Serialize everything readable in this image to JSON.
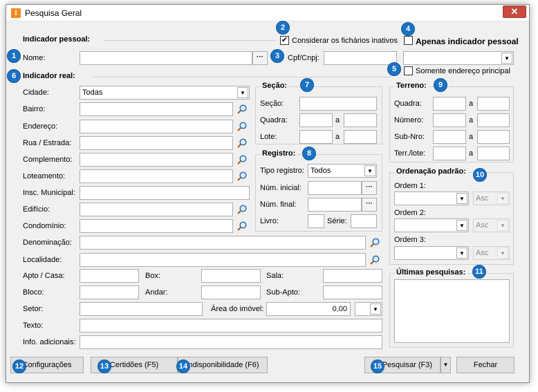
{
  "window": {
    "title": "Pesquisa Geral",
    "icon_letter": "I",
    "close_glyph": "✕"
  },
  "indicador_pessoal": {
    "label": "Indicador pessoal:",
    "nome_label": "Nome:",
    "nome_value": "",
    "cpf_label": "Cpf/Cnpj:",
    "cpf_value": "",
    "considerar_label": "Considerar os fichários inativos",
    "considerar_checked": "✔",
    "apenas_label": "Apenas indicador pessoal",
    "somente_label": "Somente endereço principal"
  },
  "indicador_real": {
    "label": "Indicador real:",
    "cidade_label": "Cidade:",
    "cidade_value": "Todas",
    "bairro_label": "Bairro:",
    "endereco_label": "Endereço:",
    "rua_label": "Rua / Estrada:",
    "complemento_label": "Complemento:",
    "loteamento_label": "Loteamento:",
    "insc_label": "Insc. Municipal:",
    "edificio_label": "Edifício:",
    "condominio_label": "Condomínio:",
    "denominacao_label": "Denominação:",
    "localidade_label": "Localidade:",
    "apto_label": "Apto / Casa:",
    "box_label": "Box:",
    "sala_label": "Sala:",
    "bloco_label": "Bloco:",
    "andar_label": "Andar:",
    "subapto_label": "Sub-Apto:",
    "setor_label": "Setor:",
    "area_label": "Área do imóvel:",
    "area_value": "0,00",
    "texto_label": "Texto:",
    "info_label": "Info. adicionais:"
  },
  "secao": {
    "title": "Seção:",
    "secao_label": "Seção:",
    "quadra_label": "Quadra:",
    "lote_label": "Lote:",
    "a": "a"
  },
  "registro": {
    "title": "Registro:",
    "tipo_label": "Tipo registro:",
    "tipo_value": "Todos",
    "inicial_label": "Núm. inicial:",
    "final_label": "Núm. final:",
    "livro_label": "Livro:",
    "serie_label": "Série:",
    "dots": "···"
  },
  "terreno": {
    "title": "Terreno:",
    "quadra_label": "Quadra:",
    "numero_label": "Número:",
    "subnro_label": "Sub-Nro:",
    "terrlote_label": "Terr./lote:",
    "a": "a"
  },
  "ordenacao": {
    "title": "Ordenação padrão:",
    "ordem1": "Ordem 1:",
    "ordem2": "Ordem 2:",
    "ordem3": "Ordem 3:",
    "asc": "Asc"
  },
  "ultimas": {
    "title": "Últimas pesquisas:"
  },
  "buttons": {
    "configuracoes": "Configurações",
    "certidoes": "Certidões (F5)",
    "indisponibilidade": "Indisponibilidade (F6)",
    "pesquisar": "Pesquisar (F3)",
    "fechar": "Fechar"
  },
  "badges": [
    "1",
    "2",
    "3",
    "4",
    "5",
    "6",
    "7",
    "8",
    "9",
    "10",
    "11",
    "12",
    "13",
    "14",
    "15"
  ],
  "colors": {
    "badge": "#1b72c4",
    "close": "#c94a3e",
    "app_icon": "#f28a1e"
  }
}
